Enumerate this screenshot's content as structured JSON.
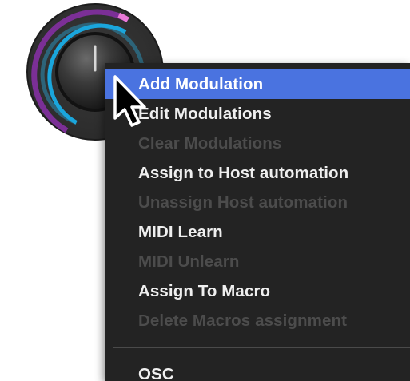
{
  "knob": {
    "accent_blue": "#1aa6dc",
    "accent_purple": "#7b2f96",
    "accent_pink": "#e87ad6",
    "track_color": "#2d6479"
  },
  "menu": {
    "items": [
      {
        "label": "Add Modulation",
        "state": "highlighted"
      },
      {
        "label": "Edit Modulations",
        "state": "enabled"
      },
      {
        "label": "Clear Modulations",
        "state": "disabled"
      },
      {
        "label": "Assign to Host automation",
        "state": "enabled"
      },
      {
        "label": "Unassign Host automation",
        "state": "disabled"
      },
      {
        "label": "MIDI Learn",
        "state": "enabled"
      },
      {
        "label": "MIDI Unlearn",
        "state": "disabled"
      },
      {
        "label": "Assign To Macro",
        "state": "enabled"
      },
      {
        "label": "Delete Macros assignment",
        "state": "disabled"
      }
    ],
    "footer_items": [
      {
        "label": "OSC",
        "state": "enabled"
      }
    ],
    "highlight_color": "#4a73e0",
    "background_color": "#232323"
  },
  "cursor": {
    "icon": "arrow-pointer-icon"
  }
}
